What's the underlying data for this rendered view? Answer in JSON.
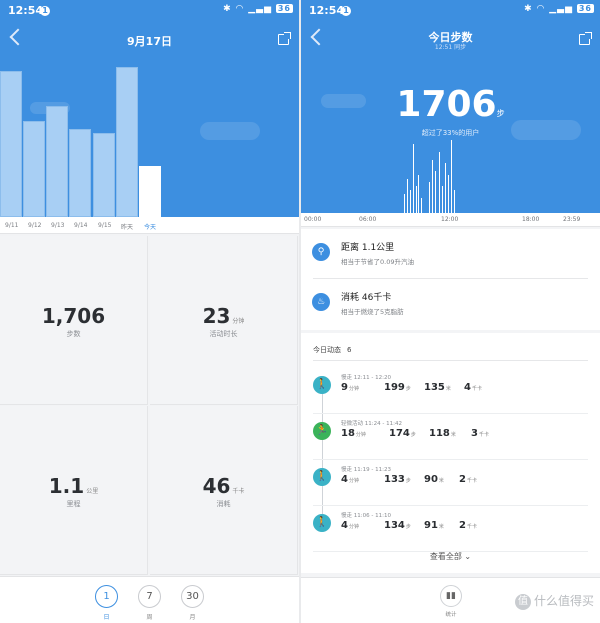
{
  "status_bar": {
    "time": "12:54",
    "notif": "1",
    "battery": "36"
  },
  "left": {
    "title": "9月17日",
    "bar_chart": {
      "categories": [
        "9/11",
        "9/12",
        "9/13",
        "9/14",
        "9/15",
        "昨天",
        "今天"
      ],
      "relative_values": [
        0.75,
        0.49,
        0.57,
        0.45,
        0.43,
        0.77,
        0.26
      ],
      "active_index": 6
    },
    "stats": [
      {
        "value": "1,706",
        "unit": "",
        "label": "步数"
      },
      {
        "value": "23",
        "unit": "分钟",
        "label": "活动时长"
      },
      {
        "value": "1.1",
        "unit": "公里",
        "label": "里程"
      },
      {
        "value": "46",
        "unit": "千卡",
        "label": "消耗"
      }
    ],
    "periods": [
      {
        "num": "1",
        "label": "日"
      },
      {
        "num": "7",
        "label": "周"
      },
      {
        "num": "30",
        "label": "月"
      }
    ]
  },
  "right": {
    "title": "今日步数",
    "sync_text": "12:51 同步",
    "steps": "1706",
    "steps_unit": "步",
    "exceed_text": "超过了33%的用户",
    "time_labels": [
      "00:00",
      "06:00",
      "12:00",
      "18:00",
      "23:59"
    ],
    "distance": {
      "title": "距离 1.1公里",
      "sub": "相当于节省了0.09升汽油"
    },
    "calories": {
      "title": "消耗 46千卡",
      "sub": "相当于燃烧了5克脂肪"
    },
    "activity": {
      "title": "今日动态",
      "count": "6",
      "items": [
        {
          "type": "慢走",
          "time": "12:11 - 12:20",
          "minutes": "9",
          "steps": "199",
          "meters": "135",
          "kcal": "4"
        },
        {
          "type": "轻微活动",
          "time": "11:24 - 11:42",
          "minutes": "18",
          "steps": "174",
          "meters": "118",
          "kcal": "3"
        },
        {
          "type": "慢走",
          "time": "11:19 - 11:23",
          "minutes": "4",
          "steps": "133",
          "meters": "90",
          "kcal": "2"
        },
        {
          "type": "慢走",
          "time": "11:06 - 11:10",
          "minutes": "4",
          "steps": "134",
          "meters": "91",
          "kcal": "2"
        }
      ],
      "units": {
        "minutes": "分钟",
        "steps": "步",
        "meters": "米",
        "kcal": "千卡"
      },
      "view_all": "查看全部"
    },
    "footer": {
      "stat_label": "统计"
    },
    "watermark": {
      "badge": "值",
      "text": "什么值得买"
    }
  },
  "colors": {
    "primary": "#3d8fe0",
    "walk": "#3ab2c6",
    "light": "#3bb35a"
  }
}
